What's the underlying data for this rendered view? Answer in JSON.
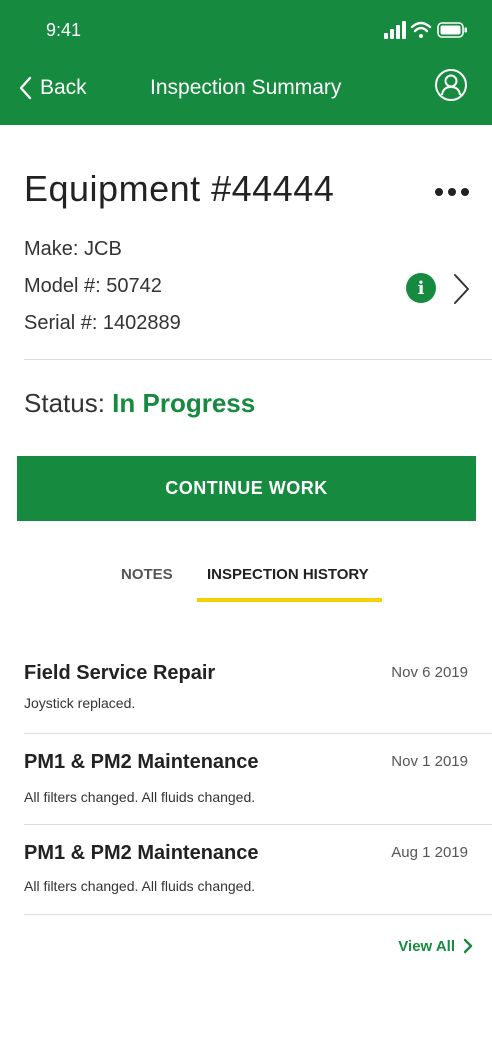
{
  "colors": {
    "brand": "#168a3f",
    "tab_indicator": "#f5d000",
    "header_text": "#ffffff"
  },
  "status_bar": {
    "time": "9:41"
  },
  "nav": {
    "back_label": "Back",
    "title": "Inspection Summary"
  },
  "equipment": {
    "title": "Equipment #44444",
    "make": "Make: JCB",
    "model": "Model #: 50742",
    "serial": "Serial #: 1402889"
  },
  "status": {
    "label": "Status:",
    "value": "In Progress"
  },
  "actions": {
    "continue_label": "CONTINUE WORK"
  },
  "tabs": [
    {
      "label": "NOTES",
      "active": false
    },
    {
      "label": "INSPECTION HISTORY",
      "active": true
    }
  ],
  "history": [
    {
      "title": "Field Service Repair",
      "date": "Nov 6 2019",
      "description": "Joystick replaced."
    },
    {
      "title": "PM1 & PM2 Maintenance",
      "date": "Nov 1 2019",
      "description": "All filters changed. All fluids changed."
    },
    {
      "title": "PM1 & PM2 Maintenance",
      "date": "Aug 1 2019",
      "description": "All filters changed. All fluids changed."
    }
  ],
  "view_all_label": "View All",
  "icons": [
    "signal-icon",
    "wifi-icon",
    "battery-icon",
    "back-chevron-icon",
    "profile-icon",
    "more-icon",
    "info-icon",
    "chevron-right-icon"
  ]
}
